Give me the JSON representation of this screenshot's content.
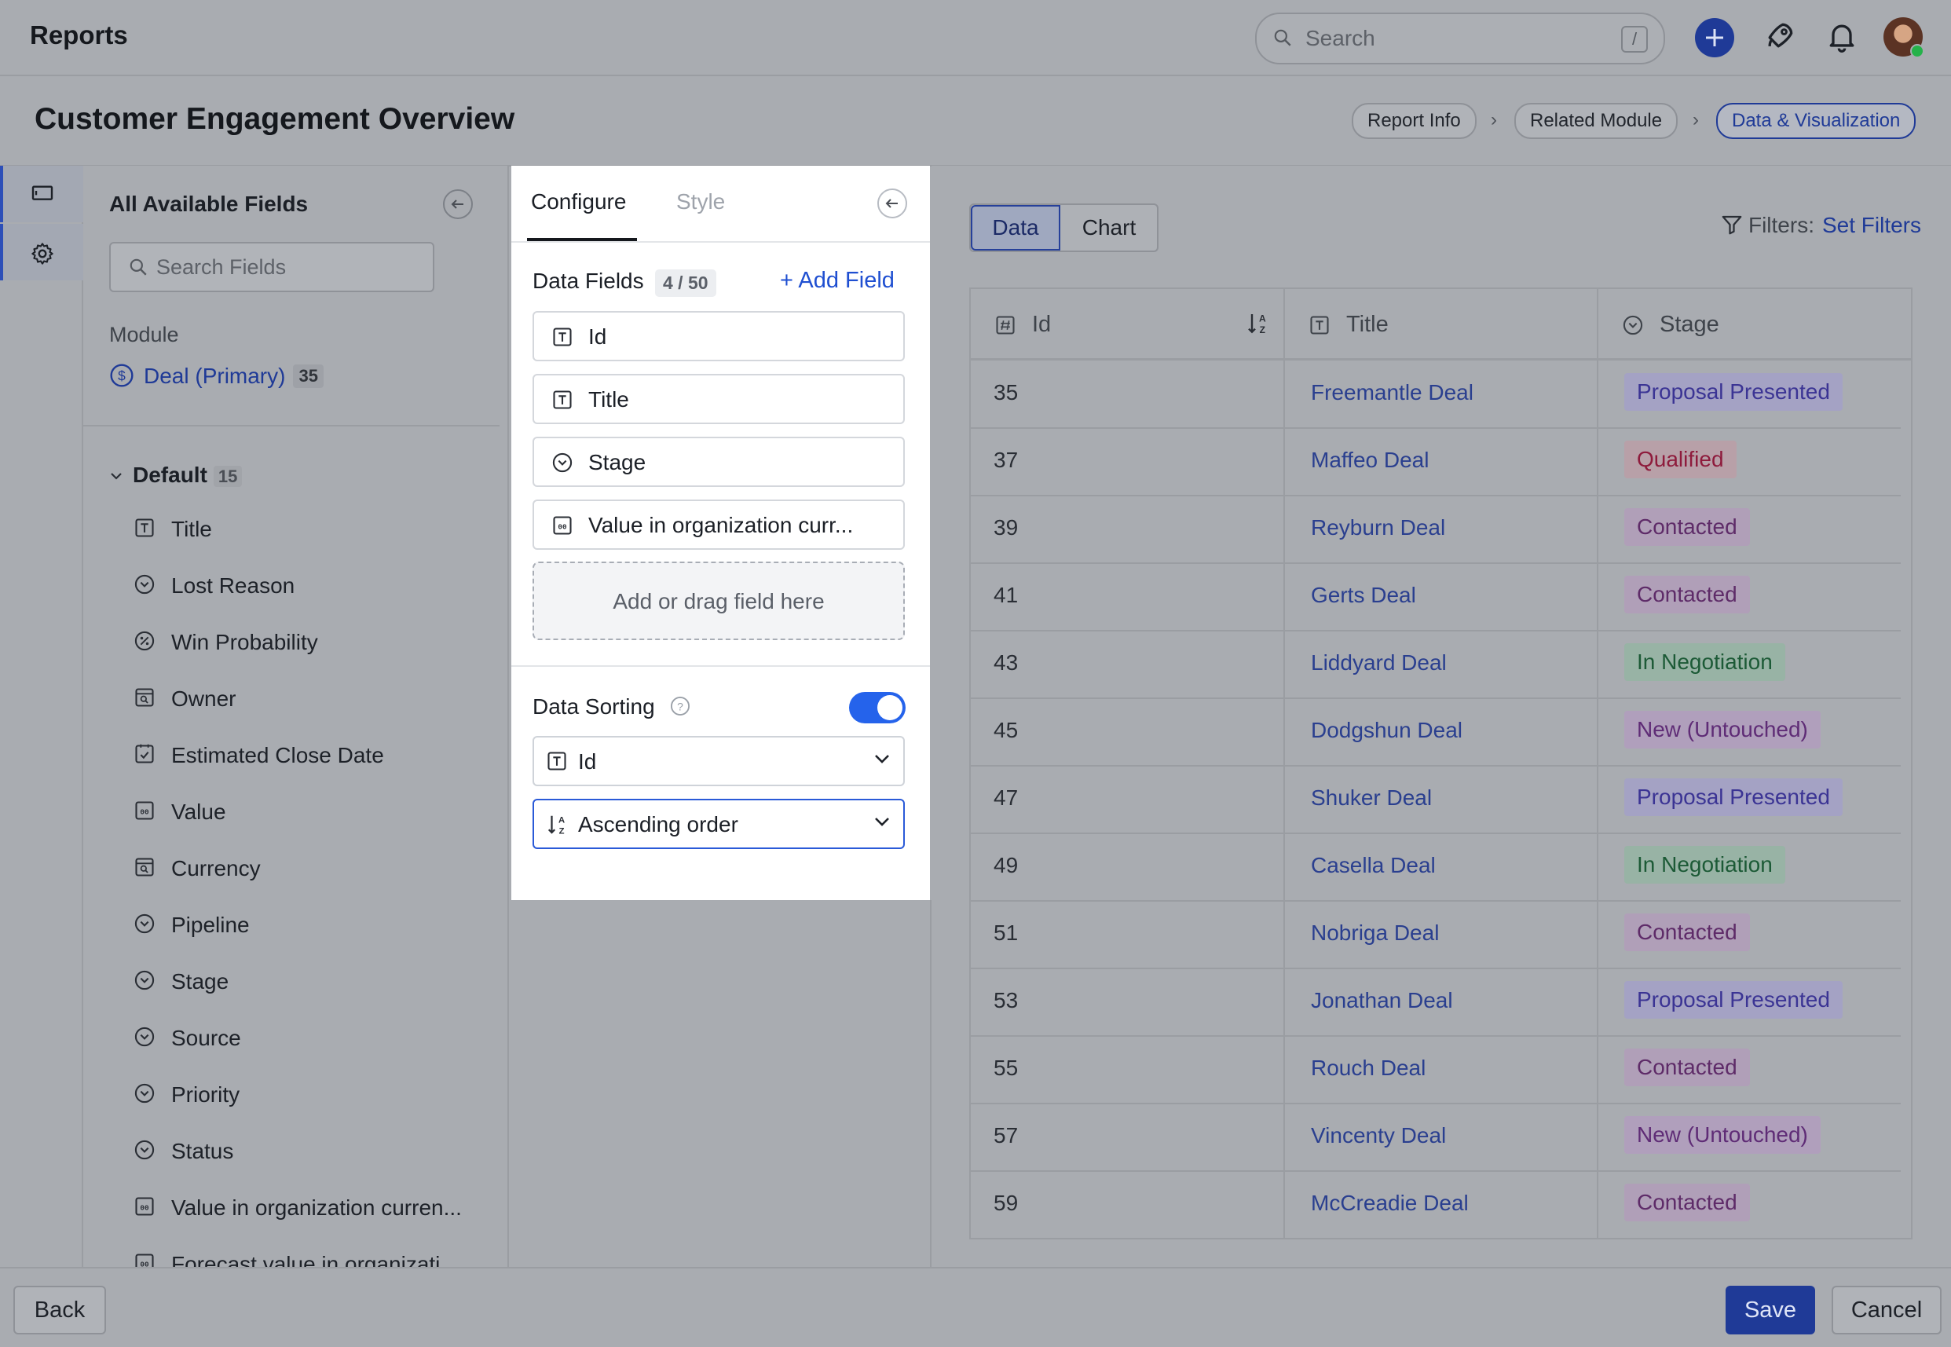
{
  "app": {
    "title": "Reports"
  },
  "search": {
    "placeholder": "Search",
    "shortcut": "/"
  },
  "page": {
    "title": "Customer Engagement Overview"
  },
  "breadcrumb": {
    "steps": [
      "Report Info",
      "Related Module",
      "Data & Visualization"
    ],
    "active": "Data & Visualization"
  },
  "rail": {
    "items": [
      "report-icon",
      "gear-icon"
    ]
  },
  "fields_panel": {
    "title": "All Available Fields",
    "search_placeholder": "Search Fields",
    "module_label": "Module",
    "module_name": "Deal (Primary)",
    "module_count": "35",
    "group_name": "Default",
    "group_count": "15",
    "fields": [
      {
        "label": "Title",
        "icon": "text-icon"
      },
      {
        "label": "Lost Reason",
        "icon": "dropdown-icon"
      },
      {
        "label": "Win Probability",
        "icon": "percent-icon"
      },
      {
        "label": "Owner",
        "icon": "lookup-icon"
      },
      {
        "label": "Estimated Close Date",
        "icon": "date-icon"
      },
      {
        "label": "Value",
        "icon": "currency-icon"
      },
      {
        "label": "Currency",
        "icon": "lookup-icon"
      },
      {
        "label": "Pipeline",
        "icon": "dropdown-icon"
      },
      {
        "label": "Stage",
        "icon": "dropdown-icon"
      },
      {
        "label": "Source",
        "icon": "dropdown-icon"
      },
      {
        "label": "Priority",
        "icon": "dropdown-icon"
      },
      {
        "label": "Status",
        "icon": "dropdown-icon"
      },
      {
        "label": "Value in organization curren...",
        "icon": "currency-icon"
      },
      {
        "label": "Forecast value in organizati...",
        "icon": "currency-icon"
      }
    ]
  },
  "configure": {
    "tabs": [
      "Configure",
      "Style"
    ],
    "active_tab": "Configure",
    "data_fields_title": "Data Fields",
    "data_fields_count": "4 / 50",
    "add_field_label": "+ Add Field",
    "fields": [
      {
        "label": "Id",
        "icon": "text-icon"
      },
      {
        "label": "Title",
        "icon": "text-icon"
      },
      {
        "label": "Stage",
        "icon": "dropdown-icon"
      },
      {
        "label": "Value in organization curr...",
        "icon": "currency-icon"
      }
    ],
    "drop_zone_label": "Add or drag field here",
    "sorting_title": "Data Sorting",
    "sorting_enabled": true,
    "sort_field": "Id",
    "sort_order": "Ascending order"
  },
  "view": {
    "segments": [
      "Data",
      "Chart"
    ],
    "active_segment": "Data",
    "filters_label": "Filters:",
    "set_filters_label": "Set Filters"
  },
  "table": {
    "columns": [
      "Id",
      "Title",
      "Stage"
    ],
    "rows": [
      {
        "id": "35",
        "title": "Freemantle Deal",
        "stage": "Proposal Presented"
      },
      {
        "id": "37",
        "title": "Maffeo Deal",
        "stage": "Qualified"
      },
      {
        "id": "39",
        "title": "Reyburn Deal",
        "stage": "Contacted"
      },
      {
        "id": "41",
        "title": "Gerts Deal",
        "stage": "Contacted"
      },
      {
        "id": "43",
        "title": "Liddyard Deal",
        "stage": "In Negotiation"
      },
      {
        "id": "45",
        "title": "Dodgshun Deal",
        "stage": "New (Untouched)"
      },
      {
        "id": "47",
        "title": "Shuker Deal",
        "stage": "Proposal Presented"
      },
      {
        "id": "49",
        "title": "Casella Deal",
        "stage": "In Negotiation"
      },
      {
        "id": "51",
        "title": "Nobriga Deal",
        "stage": "Contacted"
      },
      {
        "id": "53",
        "title": "Jonathan Deal",
        "stage": "Proposal Presented"
      },
      {
        "id": "55",
        "title": "Rouch Deal",
        "stage": "Contacted"
      },
      {
        "id": "57",
        "title": "Vincenty Deal",
        "stage": "New (Untouched)"
      },
      {
        "id": "59",
        "title": "McCreadie Deal",
        "stage": "Contacted"
      }
    ],
    "stage_colors": {
      "Proposal Presented": {
        "bg": "#a4a2c4",
        "fg": "#3b3494"
      },
      "Qualified": {
        "bg": "#b8a0a8",
        "fg": "#8e1b3c"
      },
      "Contacted": {
        "bg": "#b09fb8",
        "fg": "#5e2b68"
      },
      "In Negotiation": {
        "bg": "#98b3a5",
        "fg": "#1c5a36"
      },
      "New (Untouched)": {
        "bg": "#b09fbc",
        "fg": "#5f2c76"
      }
    }
  },
  "footer": {
    "back_label": "Back",
    "save_label": "Save",
    "cancel_label": "Cancel"
  },
  "colors": {
    "accent": "#1f3a97",
    "toggle": "#2563eb",
    "link": "#1f4fd1"
  }
}
